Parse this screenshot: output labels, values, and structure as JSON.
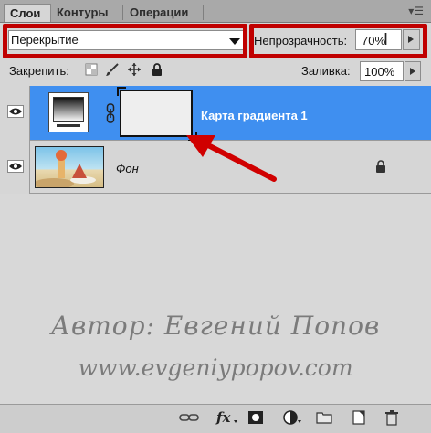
{
  "tabs": [
    {
      "label": "Слои",
      "active": true
    },
    {
      "label": "Контуры",
      "active": false
    },
    {
      "label": "Операции",
      "active": false
    }
  ],
  "panel_menu_icon": "panel-menu-icon",
  "blend_mode": {
    "value": "Перекрытие"
  },
  "opacity": {
    "label": "Непрозрачность:",
    "value": "70%"
  },
  "lock": {
    "label": "Закрепить:",
    "icons": [
      "lock-transparency-icon",
      "lock-brush-icon",
      "lock-move-icon",
      "lock-all-icon"
    ]
  },
  "fill": {
    "label": "Заливка:",
    "value": "100%"
  },
  "layers": [
    {
      "name": "Карта градиента 1",
      "type": "adjustment-gradient-map",
      "selected": true,
      "visible": true
    },
    {
      "name": "Фон",
      "type": "background-photo",
      "selected": false,
      "visible": true,
      "locked": true
    }
  ],
  "watermark": {
    "line1": "Автор: Евгений Попов",
    "line2": "www.evgeniypopov.com"
  },
  "bottom_toolbar": [
    "link-layers-icon",
    "layer-style-fx-icon",
    "add-mask-icon",
    "adjustment-layer-icon",
    "new-group-icon",
    "new-layer-icon",
    "delete-layer-icon"
  ],
  "colors": {
    "selected_row": "#3f8ff0",
    "highlight": "#c00000",
    "panel_bg": "#d6d6d6"
  }
}
